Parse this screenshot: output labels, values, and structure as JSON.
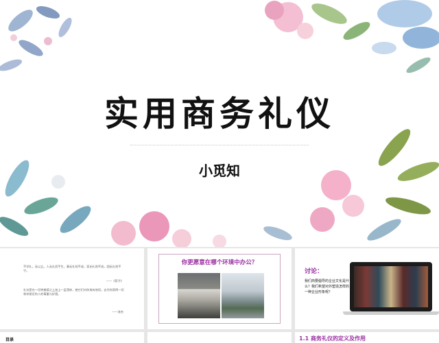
{
  "slide": {
    "title": "实用商务礼仪",
    "subtitle": "小觅知"
  },
  "thumbnails": {
    "t1": {
      "quote1": "不学礼，无以立。人无礼而不生，事无礼则不成，家无礼则不成，国无礼则不宁。",
      "source1": "——《荀子》",
      "quote2": "礼仪是在一切特美德之上加上一层藻饰，使它们对你具有效用，去为你获得一切和你接近的人的尊重与好感。",
      "source2": "——洛克"
    },
    "t2": {
      "heading": "你更愿意在哪个环境中办公？"
    },
    "t3": {
      "heading": "讨论：",
      "question": "我们商要倡导的企业文化是什么？我们希望对外塑造怎样的一种企业形象呢？"
    },
    "t4": {
      "label": "目录"
    },
    "t6": {
      "label": "1.1 商务礼仪的定义及作用"
    }
  }
}
